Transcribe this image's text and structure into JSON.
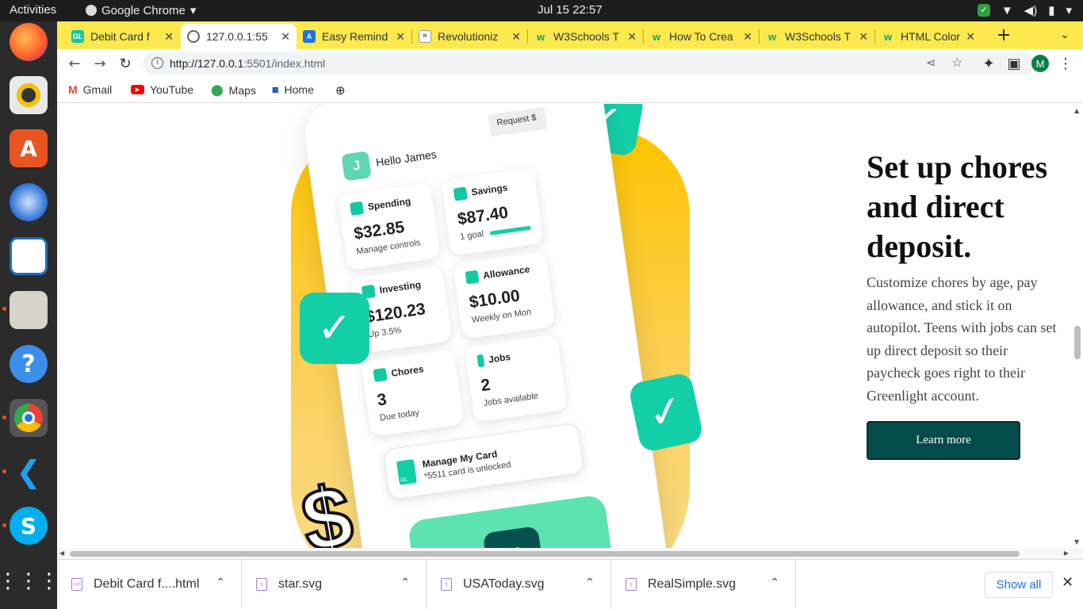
{
  "system": {
    "activities": "Activities",
    "app_name": "Google Chrome",
    "clock": "Jul 15  22:57"
  },
  "tabs": [
    {
      "title": "Debit Card f",
      "favicon": "GL",
      "color": "#13c9a3",
      "active": false
    },
    {
      "title": "127.0.0.1:55",
      "favicon": "globe",
      "color": "#5f6368",
      "active": true
    },
    {
      "title": "Easy Remind",
      "favicon": "A",
      "color": "#1a73e8",
      "active": false
    },
    {
      "title": "Revolutioniz",
      "favicon": "news",
      "color": "#555",
      "active": false
    },
    {
      "title": "W3Schools T",
      "favicon": "w3",
      "color": "#04aa6d",
      "active": false
    },
    {
      "title": "How To Crea",
      "favicon": "w3",
      "color": "#04aa6d",
      "active": false
    },
    {
      "title": "W3Schools T",
      "favicon": "w3",
      "color": "#04aa6d",
      "active": false
    },
    {
      "title": "HTML Color",
      "favicon": "w3",
      "color": "#04aa6d",
      "active": false
    }
  ],
  "omnibox": {
    "host": "http://127.0.0.1",
    "rest": ":5501/index.html"
  },
  "profile_initial": "M",
  "bookmarks": [
    {
      "label": "Gmail",
      "icon": "gmail-icon"
    },
    {
      "label": "YouTube",
      "icon": "youtube-icon"
    },
    {
      "label": "Maps",
      "icon": "maps-icon"
    },
    {
      "label": "Home",
      "icon": "home-icon"
    }
  ],
  "phone": {
    "greeting": "Hello James",
    "avatar": "J",
    "request": "Request $",
    "cards": [
      {
        "label": "Spending",
        "value": "$32.85",
        "sub": "Manage controls"
      },
      {
        "label": "Savings",
        "value": "$87.40",
        "sub": "1 goal"
      },
      {
        "label": "Investing",
        "value": "$120.23",
        "sub": "Up 3.5%"
      },
      {
        "label": "Allowance",
        "value": "$10.00",
        "sub": "Weekly on Mon"
      },
      {
        "label": "Chores",
        "value": "3",
        "sub": "Due today"
      },
      {
        "label": "Jobs",
        "value": "2",
        "sub": "Jobs available"
      }
    ],
    "manage_card": {
      "title": "Manage My Card",
      "sub": "*5511 card is unlocked",
      "logo": "GL"
    }
  },
  "hero": {
    "title": "Set up chores and direct deposit.",
    "description": "Customize chores by age, pay allowance, and stick it on autopilot. Teens with jobs can set up direct deposit so their paycheck goes right to their Greenlight account.",
    "button": "Learn more"
  },
  "downloads": [
    {
      "name": "Debit Card f....html"
    },
    {
      "name": "star.svg"
    },
    {
      "name": "USAToday.svg"
    },
    {
      "name": "RealSimple.svg"
    }
  ],
  "show_all": "Show all"
}
